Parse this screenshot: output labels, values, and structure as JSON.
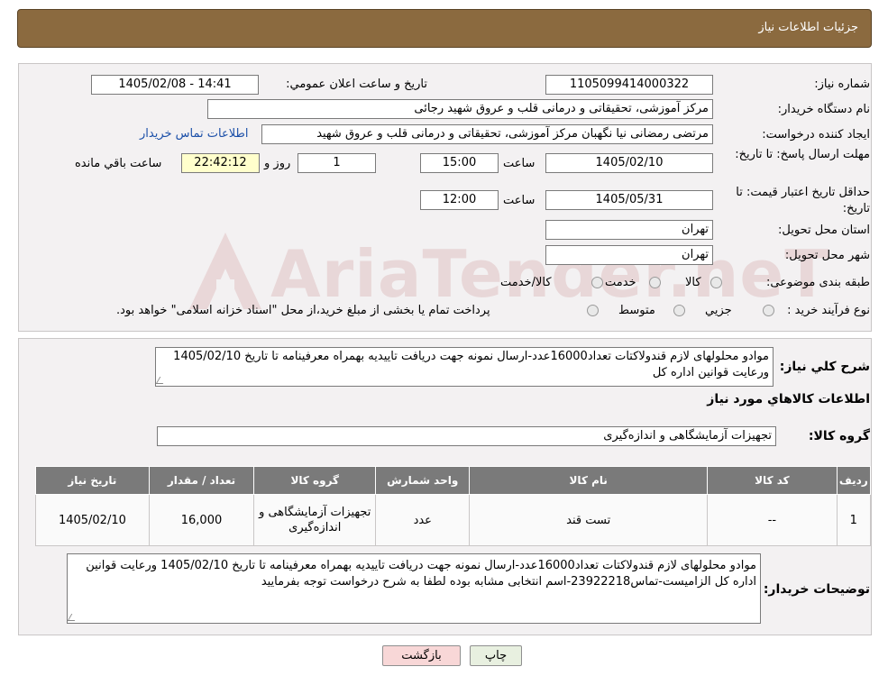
{
  "header": {
    "title": "جزئیات اطلاعات نیاز"
  },
  "labels": {
    "need_number": "شماره نیاز:",
    "announce_datetime": "تاریخ و ساعت اعلان عمومي:",
    "buyer_org": "نام دستگاه خریدار:",
    "requester": "ایجاد کننده درخواست:",
    "deadline": "مهلت ارسال پاسخ: تا تاریخ:",
    "time_word": "ساعت",
    "day_and": "روز و",
    "hours_remaining": "ساعت باقي مانده",
    "price_validity": "حداقل تاریخ اعتبار قیمت: تا تاریخ:",
    "province": "استان محل تحویل:",
    "city": "شهر محل تحویل:",
    "category": "طبقه بندی موضوعی:",
    "process_type": "نوع فرآیند خرید :",
    "description": "شرح كلي نياز:",
    "goods_info": "اطلاعات کالاهاي مورد نياز",
    "goods_group": "گروه کالا:",
    "buyer_notes": "توضیحات خریدار:"
  },
  "fields": {
    "need_number": "1105099414000322",
    "announce_datetime": "1405/02/08 - 14:41",
    "buyer_org": "مرکز آموزشی، تحقیقاتی و درمانی قلب و عروق شهید رجائی",
    "requester": "مرتضی رمضانی نیا نگهبان مرکز آموزشی، تحقیقاتی و درمانی قلب و عروق شهید",
    "contact_link": "اطلاعات تماس خریدار",
    "deadline_date": "1405/02/10",
    "deadline_time": "15:00",
    "days": "1",
    "remaining": "22:42:12",
    "validity_date": "1405/05/31",
    "validity_time": "12:00",
    "province": "تهران",
    "city": "تهران"
  },
  "category_options": [
    "کالا",
    "خدمت",
    "کالا/خدمت"
  ],
  "process_options": [
    "جزیي",
    "متوسط"
  ],
  "process_note": "پرداخت تمام یا بخشی از مبلغ خرید،از محل \"اسناد خزانه اسلامی\" خواهد بود.",
  "description_text": "موادو محلولهای لازم قندولاکتات تعداد16000عدد-ارسال نمونه جهت دریافت تاییدیه بهمراه معرفینامه تا تاریخ 1405/02/10 ورعایت قوانین اداره کل",
  "goods_group_value": "تجهیزات آزمایشگاهی و اندازه‌گیری",
  "table": {
    "headers": [
      "ردیف",
      "کد کالا",
      "نام کالا",
      "واحد شمارش",
      "گروه کالا",
      "تعداد / مقدار",
      "تاریخ نیاز"
    ],
    "rows": [
      [
        "1",
        "--",
        "تست قند",
        "عدد",
        "تجهیزات آزمایشگاهی و اندازه‌گیری",
        "16,000",
        "1405/02/10"
      ]
    ]
  },
  "buyer_notes_text": "موادو محلولهای لازم قندولاکتات تعداد16000عدد-ارسال نمونه جهت دریافت تاییدیه بهمراه معرفینامه تا تاریخ 1405/02/10 ورعایت قوانین اداره کل الزامیست-تماس23922218-اسم انتخابی مشابه بوده لطفا به شرح درخواست توجه بفرمایید",
  "buttons": {
    "print": "چاپ",
    "back": "بازگشت"
  },
  "watermark": "AriaTender.neT",
  "colors": {
    "header": "#8b6a3f",
    "table_header": "#7a7a7a",
    "back_button": "#f8d7d7"
  }
}
